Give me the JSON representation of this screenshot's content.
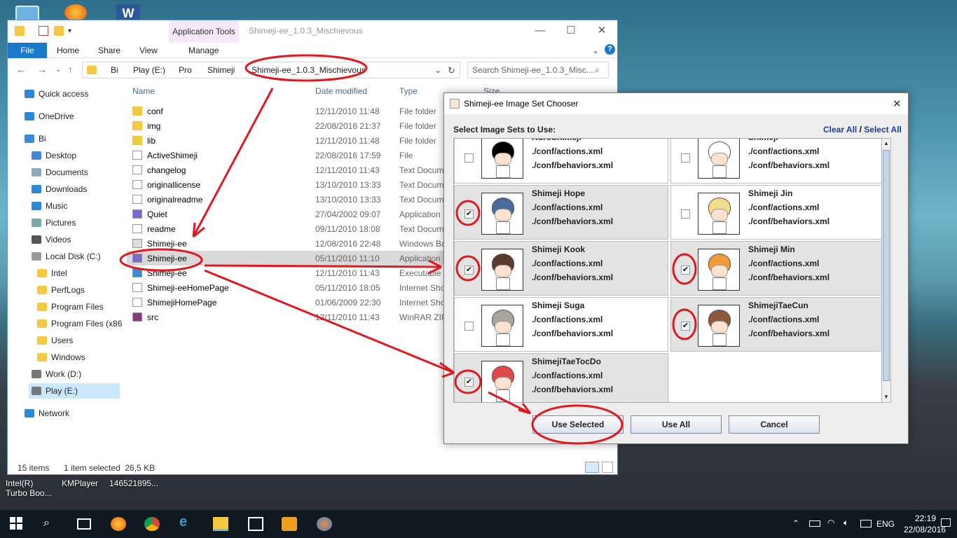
{
  "desktop": {
    "icons": [
      {
        "label": "Intel(R)\nTurbo Boo..."
      },
      {
        "label": "KMPlayer"
      },
      {
        "label": "146521895..."
      }
    ],
    "top_icons": [
      "pc-icon",
      "firefox-icon",
      "word-icon"
    ]
  },
  "explorer": {
    "title": "Shimeji-ee_1.0.3_Mischievous",
    "context_tab": "Application Tools",
    "context_sub": "Manage",
    "tabs": [
      "File",
      "Home",
      "Share",
      "View"
    ],
    "window_buttons": [
      "—",
      "☐",
      "✕"
    ],
    "breadcrumb": [
      "Bi",
      "Play (E:)",
      "Pro",
      "Shimeji",
      "Shimeji-ee_1.0.3_Mischievous"
    ],
    "search_placeholder": "Search Shimeji-ee_1.0.3_Misc...",
    "nav": [
      {
        "label": "Quick access",
        "icon": "star"
      },
      {
        "label": "OneDrive",
        "icon": "cloud"
      },
      {
        "label": "Bi",
        "icon": "pc"
      },
      {
        "label": "Desktop",
        "icon": "desktop"
      },
      {
        "label": "Documents",
        "icon": "documents"
      },
      {
        "label": "Downloads",
        "icon": "downloads"
      },
      {
        "label": "Music",
        "icon": "music"
      },
      {
        "label": "Pictures",
        "icon": "pictures"
      },
      {
        "label": "Videos",
        "icon": "videos"
      },
      {
        "label": "Local Disk (C:)",
        "icon": "disk"
      },
      {
        "label": "Intel",
        "icon": "folder"
      },
      {
        "label": "PerfLogs",
        "icon": "folder"
      },
      {
        "label": "Program Files",
        "icon": "folder"
      },
      {
        "label": "Program Files (x86",
        "icon": "folder"
      },
      {
        "label": "Users",
        "icon": "folder"
      },
      {
        "label": "Windows",
        "icon": "folder"
      },
      {
        "label": "Work (D:)",
        "icon": "drive"
      },
      {
        "label": "Play (E:)",
        "icon": "drive"
      },
      {
        "label": "Network",
        "icon": "network"
      }
    ],
    "columns": [
      "Name",
      "Date modified",
      "Type",
      "Size"
    ],
    "files": [
      {
        "name": "conf",
        "date": "12/11/2010 11:48",
        "type": "File folder",
        "icon": "folder"
      },
      {
        "name": "img",
        "date": "22/08/2016 21:37",
        "type": "File folder",
        "icon": "folder"
      },
      {
        "name": "lib",
        "date": "12/11/2010 11:48",
        "type": "File folder",
        "icon": "folder"
      },
      {
        "name": "ActiveShimeji",
        "date": "22/08/2016 17:59",
        "type": "File",
        "icon": "file"
      },
      {
        "name": "changelog",
        "date": "12/11/2010 11:43",
        "type": "Text Docum",
        "icon": "text"
      },
      {
        "name": "originallicense",
        "date": "13/10/2010 13:33",
        "type": "Text Docum",
        "icon": "text"
      },
      {
        "name": "originalreadme",
        "date": "13/10/2010 13:33",
        "type": "Text Docum",
        "icon": "text"
      },
      {
        "name": "Quiet",
        "date": "27/04/2002 09:07",
        "type": "Application",
        "icon": "app"
      },
      {
        "name": "readme",
        "date": "09/11/2010 18:08",
        "type": "Text Docum",
        "icon": "text"
      },
      {
        "name": "Shimeji-ee",
        "date": "12/08/2016 22:48",
        "type": "Windows Ba",
        "icon": "bat"
      },
      {
        "name": "Shimeji-ee",
        "date": "05/11/2010 11:10",
        "type": "Application",
        "icon": "app"
      },
      {
        "name": "Shimeji-ee",
        "date": "12/11/2010 11:43",
        "type": "Executable",
        "icon": "jar"
      },
      {
        "name": "Shimeji-eeHomePage",
        "date": "05/11/2010 18:05",
        "type": "Internet Sho",
        "icon": "link"
      },
      {
        "name": "ShimejiHomePage",
        "date": "01/06/2009 22:30",
        "type": "Internet Sho",
        "icon": "link"
      },
      {
        "name": "src",
        "date": "12/11/2010 11:43",
        "type": "WinRAR ZIP",
        "icon": "zip"
      }
    ],
    "selected_index": 10,
    "status": {
      "count": "15 items",
      "selected": "1 item selected  26,5 KB"
    }
  },
  "dialog": {
    "title": "Shimeji-ee Image Set Chooser",
    "prompt": "Select Image Sets to Use:",
    "clear_all": "Clear All",
    "sep": "/",
    "select_all": "Select All",
    "sets": [
      {
        "name": "KuroShimeji",
        "actions": "./conf/actions.xml",
        "behaviors": "./conf/behaviors.xml",
        "checked": false,
        "hair": "#000000"
      },
      {
        "name": "Shimeji",
        "actions": "./conf/actions.xml",
        "behaviors": "./conf/behaviors.xml",
        "checked": false,
        "hair": "#ffffff"
      },
      {
        "name": "Shimeji Hope",
        "actions": "./conf/actions.xml",
        "behaviors": "./conf/behaviors.xml",
        "checked": true,
        "hair": "#4a6a9c"
      },
      {
        "name": "Shimeji Jin",
        "actions": "./conf/actions.xml",
        "behaviors": "./conf/behaviors.xml",
        "checked": false,
        "hair": "#f3dd8a"
      },
      {
        "name": "Shimeji Kook",
        "actions": "./conf/actions.xml",
        "behaviors": "./conf/behaviors.xml",
        "checked": true,
        "hair": "#5b3b2e"
      },
      {
        "name": "Shimeji Min",
        "actions": "./conf/actions.xml",
        "behaviors": "./conf/behaviors.xml",
        "checked": true,
        "hair": "#f29a3a"
      },
      {
        "name": "Shimeji Suga",
        "actions": "./conf/actions.xml",
        "behaviors": "./conf/behaviors.xml",
        "checked": false,
        "hair": "#a9a59a"
      },
      {
        "name": "ShimejiTaeCun",
        "actions": "./conf/actions.xml",
        "behaviors": "./conf/behaviors.xml",
        "checked": true,
        "hair": "#8a5a3c"
      },
      {
        "name": "ShimejiTaeTocDo",
        "actions": "./conf/actions.xml",
        "behaviors": "./conf/behaviors.xml",
        "checked": true,
        "hair": "#e0484a"
      }
    ],
    "buttons": {
      "use_selected": "Use Selected",
      "use_all": "Use All",
      "cancel": "Cancel"
    },
    "check_glyph": "✔",
    "close": "✕"
  },
  "taskbar": {
    "lang": "ENG",
    "time": "22:19",
    "date": "22/08/2016"
  },
  "colors": {
    "accent": "#1979ca",
    "annotation": "#e0181f",
    "link": "#1a3aa8"
  }
}
